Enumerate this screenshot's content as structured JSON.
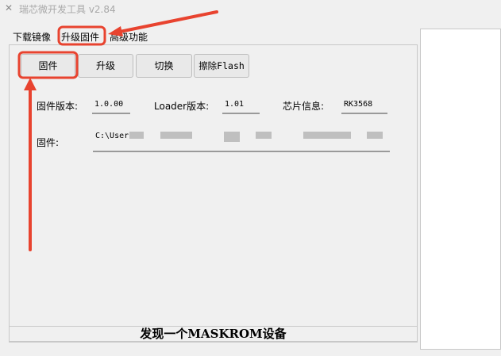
{
  "window": {
    "title": "瑞芯微开发工具 v2.84",
    "icon": "crossed-tools-icon"
  },
  "tabs": [
    {
      "label": "下载镜像",
      "selected": false
    },
    {
      "label": "升级固件",
      "selected": true
    },
    {
      "label": "高级功能",
      "selected": false
    }
  ],
  "toolbar": {
    "firmware_label": "固件",
    "upgrade_label": "升级",
    "switch_label": "切换",
    "erase_label": "擦除Flash"
  },
  "info": {
    "firmware_version_label": "固件版本:",
    "firmware_version_value": "1.0.00",
    "loader_version_label": "Loader版本:",
    "loader_version_value": "1.01",
    "chip_info_label": "芯片信息:",
    "chip_info_value": "RK3568",
    "firmware_path_label": "固件:",
    "firmware_path_value": "C:\\Users"
  },
  "status": {
    "text": "发现一个MASKROM设备"
  },
  "annotation_color": "#e8432f"
}
